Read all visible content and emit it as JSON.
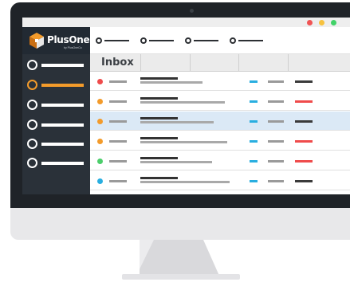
{
  "app": {
    "brand_name": "PlusOne",
    "brand_tagline": "by PlusOneCo"
  },
  "window_controls": [
    {
      "name": "close",
      "color": "#f05454"
    },
    {
      "name": "minimize",
      "color": "#f7c23f"
    },
    {
      "name": "maximize",
      "color": "#42d268"
    }
  ],
  "top_nav": {
    "item_count": 4
  },
  "sidebar": {
    "item_count": 6,
    "active_index": 1,
    "active_color": "#f39b2b"
  },
  "inbox": {
    "title": "Inbox",
    "selected_row": 2,
    "rows": [
      {
        "status_color": "#ef4b4b",
        "flag_color": "#3a3a3a",
        "preview_fraction": 0.7
      },
      {
        "status_color": "#f39b2b",
        "flag_color": "#ef4b4b",
        "preview_fraction": 0.95
      },
      {
        "status_color": "#f39b2b",
        "flag_color": "#3a3a3a",
        "preview_fraction": 0.82
      },
      {
        "status_color": "#f39b2b",
        "flag_color": "#ef4b4b",
        "preview_fraction": 0.97
      },
      {
        "status_color": "#4cce6b",
        "flag_color": "#ef4b4b",
        "preview_fraction": 0.8
      },
      {
        "status_color": "#29aee0",
        "flag_color": "#3a3a3a",
        "preview_fraction": 1.0
      }
    ]
  }
}
